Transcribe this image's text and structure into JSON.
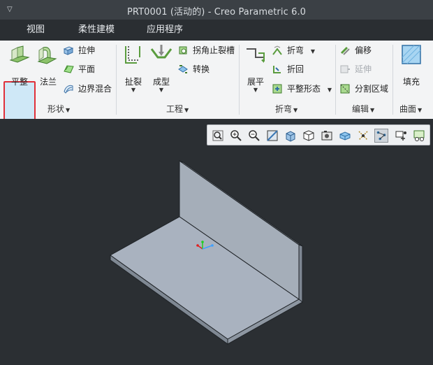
{
  "window": {
    "title": "PRT0001 (活动的) - Creo Parametric 6.0"
  },
  "tabs": [
    {
      "label": "视图"
    },
    {
      "label": "柔性建模"
    },
    {
      "label": "应用程序"
    }
  ],
  "ribbon": {
    "shape": {
      "label": "形状",
      "flat": "平整",
      "flange": "法兰",
      "extrude": "拉伸",
      "planar": "平面",
      "boundary_blend": "边界混合"
    },
    "engineering": {
      "label": "工程",
      "rip": "扯裂",
      "form": "成型",
      "corner_relief": "拐角止裂槽",
      "convert": "转换"
    },
    "bends": {
      "label": "折弯",
      "unbend": "展平",
      "bend": "折弯",
      "bend_back": "折回",
      "flatten_form": "平整形态"
    },
    "editing": {
      "label": "编辑",
      "offset": "偏移",
      "extend": "延伸",
      "split_area": "分割区域"
    },
    "surfaces": {
      "label": "曲面",
      "fill": "填充"
    }
  },
  "view_toolbar": {
    "icons": [
      "zoom-fit-icon",
      "zoom-in-icon",
      "zoom-out-icon",
      "repaint-icon",
      "display-style-icon",
      "saved-orientations-icon",
      "view-manager-icon",
      "perspective-icon",
      "datum-display-icon",
      "spin-center-icon",
      "annotation-display-icon",
      "sheetmetal-display-icon"
    ]
  },
  "colors": {
    "accent": "#e0303a",
    "selection": "#cfe8f7",
    "background": "#2b2f33",
    "model": "#a9b2bf"
  }
}
